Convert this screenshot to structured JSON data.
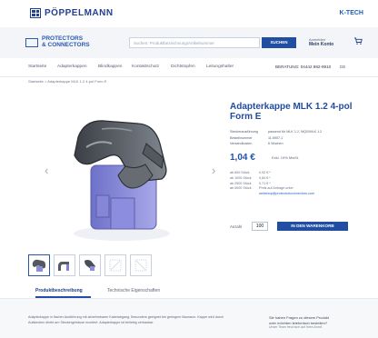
{
  "header": {
    "brand": "PÖPPELMANN",
    "sub_brand_lines": [
      "PROTECTORS",
      "& CONNECTORS"
    ],
    "k_tech": "K-TECH"
  },
  "search": {
    "placeholder": "Suchen: Produktbezeichnung/Artikelnummer",
    "button": "SUCHEN"
  },
  "account": {
    "label": "Anmelden",
    "value": "Mein Konto"
  },
  "menu": {
    "items": [
      "Startseite",
      "Adapterkappen",
      "Blindkappen",
      "Kontaktschutz",
      "Dichtstopfen",
      "Leitungshalter"
    ],
    "hotline": "BERATUNG: 04442 982-9910",
    "lang": "DE"
  },
  "breadcrumb": "Startseite > Adapterkappe MLK 1.2 4-pol Form E",
  "product": {
    "title": "Adapterkappe MLK 1.2 4-pol Form E",
    "specs": [
      {
        "label": "Steckerausführung",
        "value": "passend für MLK 1.2, MQS/MLK 1.2"
      },
      {
        "label": "Bestellnummer",
        "value": "11.6907.1"
      },
      {
        "label": "Versandkosten",
        "value": "6 Wochen"
      }
    ],
    "price": "1,04 €",
    "price_note": "Exkl. 19% MwSt.",
    "tiers": [
      {
        "label": "ab 600 Stück",
        "value": "0,92 € *"
      },
      {
        "label": "ab 1000 Stück",
        "value": "0,84 € *"
      },
      {
        "label": "ab 2500 Stück",
        "value": "0,71 € *"
      },
      {
        "label": "ab 5000 Stück",
        "value": "Preis auf Anfrage unter"
      },
      {
        "label": "",
        "value": "webshop@protectorsconnectors.com"
      }
    ],
    "quantity_label": "Anzahl",
    "quantity_value": "100",
    "cart_button": "IN DEN WARENKORB"
  },
  "tabs": [
    "Produktbeschreibung",
    "Technische Eigenschaften"
  ],
  "description": "Adapterkappe in flacher Ausführung mit abnehmbaren Kabelabgang. Besonders geeignet bei geringem Bauraum. Kappe wird durch Aufstecken direkt am Steckergehäuse montiert. Adapterkappe ist beliebig verbaubar.",
  "contact": {
    "line1": "Sie haben Fragen zu diesem Produkt",
    "line2": "oder möchten telefonisch bestellen?",
    "line3": "Unser Team freut sich auf Ihren Anruf."
  }
}
